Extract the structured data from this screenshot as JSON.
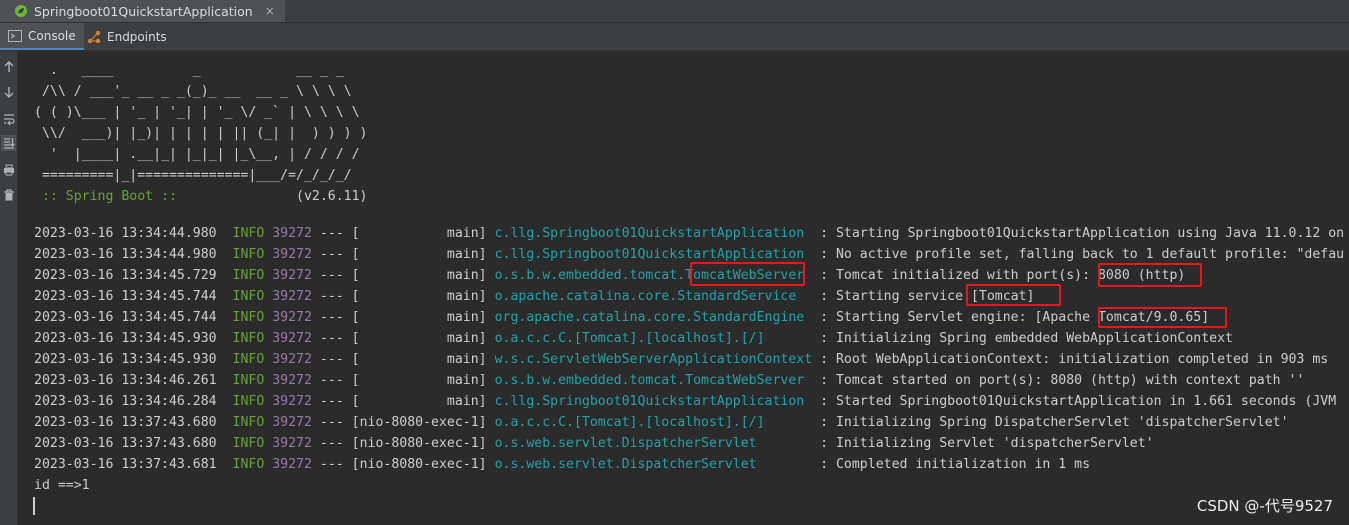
{
  "window": {
    "tab_title": "Springboot01QuickstartApplication",
    "close_glyph": "×"
  },
  "tool_tabs": [
    {
      "label": "Console",
      "icon": "console-icon",
      "active": true
    },
    {
      "label": "Endpoints",
      "icon": "endpoints-icon",
      "active": false
    }
  ],
  "gutter": [
    "arrow-up-icon",
    "arrow-down-icon",
    "soft-wrap-icon",
    "scroll-to-end-icon",
    "print-icon",
    "trash-icon"
  ],
  "banner": {
    "art": [
      "  .   ____          _            __ _ _",
      " /\\\\ / ___'_ __ _ _(_)_ __  __ _ \\ \\ \\ \\",
      "( ( )\\___ | '_ | '_| | '_ \\/ _` | \\ \\ \\ \\",
      " \\\\/  ___)| |_)| | | | | || (_| |  ) ) ) )",
      "  '  |____| .__|_| |_|_| |_\\__, | / / / /",
      " =========|_|==============|___/=/_/_/_/"
    ],
    "boot_label": " :: Spring Boot :: ",
    "boot_version": "              (v2.6.11)"
  },
  "logs": [
    {
      "ts": "2023-03-16 13:34:44.980",
      "level": "INFO",
      "pid": "39272",
      "thread": "[           main]",
      "logger": "c.llg.Springboot01QuickstartApplication ",
      "msg": " : Starting Springboot01QuickstartApplication using Java 11.0.12 on"
    },
    {
      "ts": "2023-03-16 13:34:44.980",
      "level": "INFO",
      "pid": "39272",
      "thread": "[           main]",
      "logger": "c.llg.Springboot01QuickstartApplication ",
      "msg": " : No active profile set, falling back to 1 default profile: \"defau"
    },
    {
      "ts": "2023-03-16 13:34:45.729",
      "level": "INFO",
      "pid": "39272",
      "thread": "[           main]",
      "logger": "o.s.b.w.embedded.tomcat.TomcatWebServer ",
      "msg": " : Tomcat initialized with port(s): 8080 (http)"
    },
    {
      "ts": "2023-03-16 13:34:45.744",
      "level": "INFO",
      "pid": "39272",
      "thread": "[           main]",
      "logger": "o.apache.catalina.core.StandardService  ",
      "msg": " : Starting service [Tomcat]"
    },
    {
      "ts": "2023-03-16 13:34:45.744",
      "level": "INFO",
      "pid": "39272",
      "thread": "[           main]",
      "logger": "org.apache.catalina.core.StandardEngine ",
      "msg": " : Starting Servlet engine: [Apache Tomcat/9.0.65]"
    },
    {
      "ts": "2023-03-16 13:34:45.930",
      "level": "INFO",
      "pid": "39272",
      "thread": "[           main]",
      "logger": "o.a.c.c.C.[Tomcat].[localhost].[/]      ",
      "msg": " : Initializing Spring embedded WebApplicationContext"
    },
    {
      "ts": "2023-03-16 13:34:45.930",
      "level": "INFO",
      "pid": "39272",
      "thread": "[           main]",
      "logger": "w.s.c.ServletWebServerApplicationContext",
      "msg": " : Root WebApplicationContext: initialization completed in 903 ms"
    },
    {
      "ts": "2023-03-16 13:34:46.261",
      "level": "INFO",
      "pid": "39272",
      "thread": "[           main]",
      "logger": "o.s.b.w.embedded.tomcat.TomcatWebServer ",
      "msg": " : Tomcat started on port(s): 8080 (http) with context path ''"
    },
    {
      "ts": "2023-03-16 13:34:46.284",
      "level": "INFO",
      "pid": "39272",
      "thread": "[           main]",
      "logger": "c.llg.Springboot01QuickstartApplication ",
      "msg": " : Started Springboot01QuickstartApplication in 1.661 seconds (JVM"
    },
    {
      "ts": "2023-03-16 13:37:43.680",
      "level": "INFO",
      "pid": "39272",
      "thread": "[nio-8080-exec-1]",
      "logger": "o.a.c.c.C.[Tomcat].[localhost].[/]      ",
      "msg": " : Initializing Spring DispatcherServlet 'dispatcherServlet'"
    },
    {
      "ts": "2023-03-16 13:37:43.680",
      "level": "INFO",
      "pid": "39272",
      "thread": "[nio-8080-exec-1]",
      "logger": "o.s.web.servlet.DispatcherServlet       ",
      "msg": " : Initializing Servlet 'dispatcherServlet'"
    },
    {
      "ts": "2023-03-16 13:37:43.681",
      "level": "INFO",
      "pid": "39272",
      "thread": "[nio-8080-exec-1]",
      "logger": "o.s.web.servlet.DispatcherServlet       ",
      "msg": " : Completed initialization in 1 ms"
    }
  ],
  "output_line": "id ==>1",
  "watermark": "CSDN @-代号9527",
  "colors": {
    "background": "#2b2b2b",
    "info": "#6a9e38",
    "pid": "#9876aa",
    "logger": "#21a1a6",
    "highlight": "#e5191d"
  }
}
